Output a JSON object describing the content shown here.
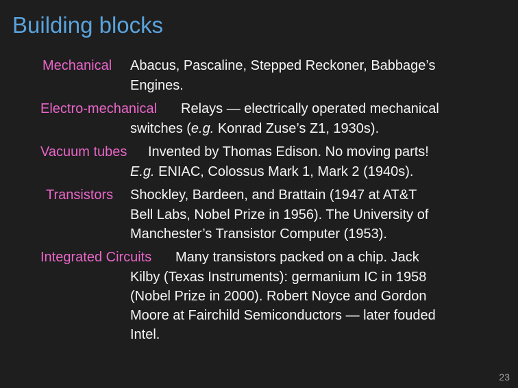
{
  "slide": {
    "title": "Building blocks",
    "page_number": "23"
  },
  "entries": [
    {
      "term": "Mechanical",
      "first_line": "Abacus, Pascaline, Stepped Reckoner, Babbage’s",
      "continuation": [
        "Engines."
      ]
    },
    {
      "term": "Electro-mechanical",
      "first_line": "Relays — electrically operated mechanical",
      "cont_prefix": "switches (",
      "cont_em": "e.g.",
      "cont_suffix": " Konrad Zuse’s Z1, 1930s)."
    },
    {
      "term": "Vacuum tubes",
      "first_line": "Invented by Thomas Edison. No moving parts!",
      "cont_em": "E.g.",
      "cont_suffix": " ENIAC, Colossus Mark 1, Mark 2 (1940s)."
    },
    {
      "term": "Transistors",
      "first_line": "Shockley, Bardeen, and Brattain (1947 at AT&T",
      "continuation": [
        "Bell Labs, Nobel Prize in 1956). The University of",
        "Manchester’s Transistor Computer (1953)."
      ]
    },
    {
      "term": "Integrated Circuits",
      "first_line": "Many transistors packed on a chip. Jack",
      "continuation": [
        "Kilby (Texas Instruments): germanium IC in 1958",
        "(Nobel Prize in 2000). Robert Noyce and Gordon",
        "Moore at Fairchild Semiconductors — later fouded",
        "Intel."
      ]
    }
  ]
}
